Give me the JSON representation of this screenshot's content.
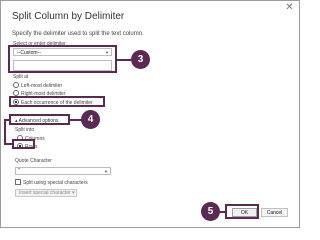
{
  "dialog": {
    "title": "Split Column by Delimiter",
    "subtitle": "Specify the delimiter used to split the text column."
  },
  "delimiter": {
    "label": "Select or enter delimiter",
    "selected": "--Custom--",
    "custom_value": ""
  },
  "split_at": {
    "label": "Split at",
    "options": [
      "Left-most delimiter",
      "Right-most delimiter",
      "Each occurrence of the delimiter"
    ],
    "selected": "Each occurrence of the delimiter"
  },
  "advanced": {
    "toggle_label": "▴ Advanced options",
    "split_into_label": "Split into",
    "options": [
      "Columns",
      "Rows"
    ],
    "selected": "Rows"
  },
  "quote": {
    "label": "Quote Character",
    "selected": "\""
  },
  "special": {
    "checkbox_label": "Split using special characters",
    "insert_label": "Insert special character ▾"
  },
  "buttons": {
    "ok": "OK",
    "cancel": "Cancel"
  },
  "callouts": {
    "c3": "3",
    "c4": "4",
    "c5": "5"
  },
  "colors": {
    "callout": "#5b2a53"
  }
}
